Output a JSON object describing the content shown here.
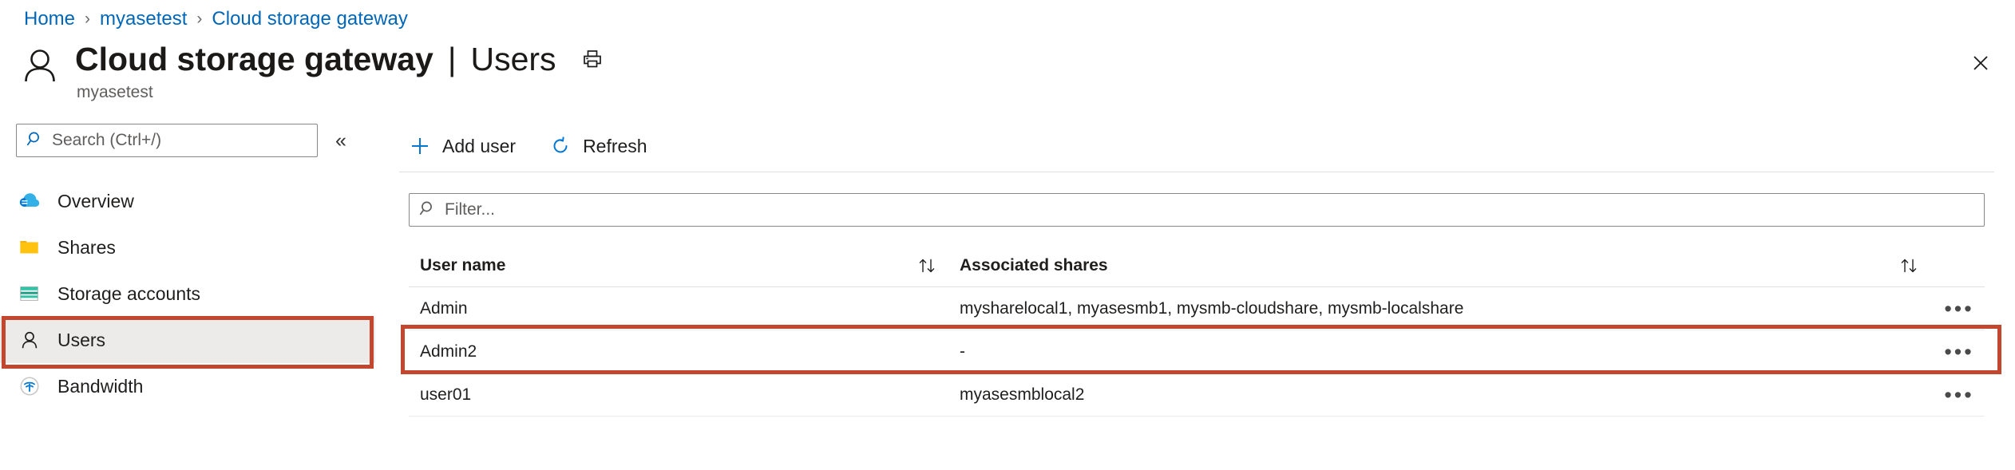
{
  "breadcrumb": {
    "items": [
      {
        "label": "Home"
      },
      {
        "label": "myasetest"
      },
      {
        "label": "Cloud storage gateway"
      }
    ],
    "separator": "›"
  },
  "header": {
    "icon": "user-outline-icon",
    "title": "Cloud storage gateway",
    "separator": "|",
    "subtitle": "Users",
    "caption": "myasetest",
    "print_icon": "printer-icon",
    "close_icon": "close-icon"
  },
  "sidebar": {
    "search": {
      "icon": "search-icon",
      "placeholder": "Search (Ctrl+/)",
      "value": ""
    },
    "collapse_icon": "«",
    "items": [
      {
        "label": "Overview",
        "icon": "cloud-icon",
        "selected": false
      },
      {
        "label": "Shares",
        "icon": "folder-icon",
        "selected": false
      },
      {
        "label": "Storage accounts",
        "icon": "storage-account-icon",
        "selected": false
      },
      {
        "label": "Users",
        "icon": "user-icon",
        "selected": true
      },
      {
        "label": "Bandwidth",
        "icon": "bandwidth-icon",
        "selected": false
      }
    ]
  },
  "toolbar": {
    "add_user_label": "Add user",
    "add_user_icon": "plus-icon",
    "refresh_label": "Refresh",
    "refresh_icon": "refresh-icon"
  },
  "filter": {
    "icon": "search-icon",
    "placeholder": "Filter...",
    "value": ""
  },
  "table": {
    "columns": [
      {
        "label": "User name",
        "sort_icon": "sort-arrows-icon"
      },
      {
        "label": "Associated shares",
        "sort_icon": "sort-arrows-icon"
      }
    ],
    "rows": [
      {
        "user_name": "Admin",
        "associated_shares": "mysharelocal1, myasesmb1, mysmb-cloudshare, mysmb-localshare",
        "menu_icon": "ellipsis-icon",
        "highlighted": false
      },
      {
        "user_name": "Admin2",
        "associated_shares": "-",
        "menu_icon": "ellipsis-icon",
        "highlighted": true
      },
      {
        "user_name": "user01",
        "associated_shares": "myasesmblocal2",
        "menu_icon": "ellipsis-icon",
        "highlighted": false
      }
    ]
  },
  "annotations": {
    "color": "#c3472f",
    "targets": [
      "sidebar-item-users",
      "table-row-admin2"
    ]
  },
  "colors": {
    "link": "#0067b8",
    "accent": "#0078d4",
    "highlight": "#c3472f",
    "selected_bg": "#edebe9"
  }
}
